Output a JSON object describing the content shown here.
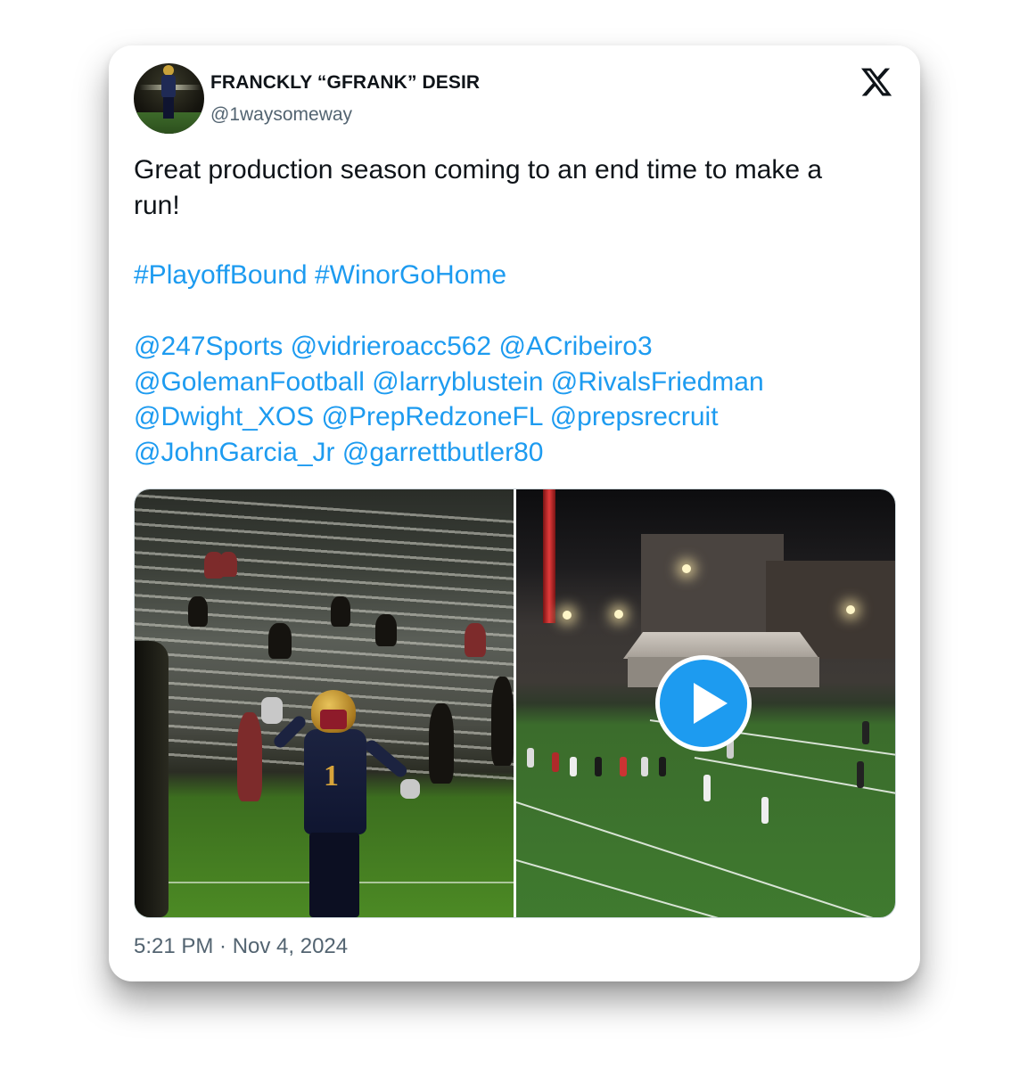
{
  "author": {
    "display_name": "FRANCKLY “GFRANK” DESIR",
    "handle": "@1waysomeway",
    "avatar_icon": "avatar-photo"
  },
  "platform_icon": "x-logo-icon",
  "tweet": {
    "text_line1": "Great production season coming to an end time to make a",
    "text_line2": "run!",
    "hashtags": [
      "#PlayoffBound",
      "#WinorGoHome"
    ],
    "mention_lines": [
      [
        "@247Sports",
        "@vidrieroacc562",
        "@ACribeiro3"
      ],
      [
        "@GolemanFootball",
        "@larryblustein",
        "@RivalsFriedman"
      ],
      [
        "@Dwight_XOS",
        "@PrepRedzoneFL",
        "@prepsrecruit"
      ],
      [
        "@JohnGarcia_Jr",
        "@garrettbutler80"
      ]
    ],
    "timestamp": "5:21 PM · Nov 4, 2024"
  },
  "media": {
    "photo_icon": "football-player-photo",
    "video_icon": "football-field-video",
    "play_icon": "play-icon"
  },
  "colors": {
    "link": "#1d9bf0",
    "text": "#0f1419",
    "secondary": "#536471"
  }
}
